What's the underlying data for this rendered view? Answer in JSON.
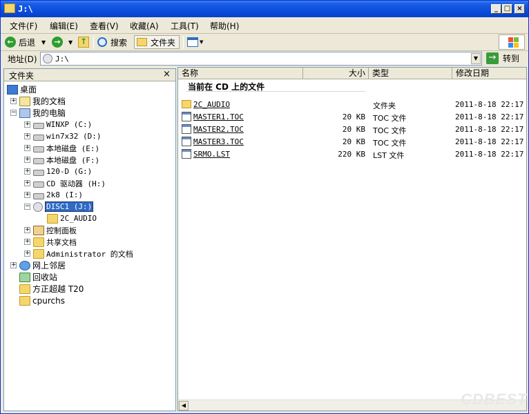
{
  "window": {
    "title": "J:\\",
    "minimize": "_",
    "maximize": "□",
    "close": "×"
  },
  "menu": [
    "文件(F)",
    "编辑(E)",
    "查看(V)",
    "收藏(A)",
    "工具(T)",
    "帮助(H)"
  ],
  "toolbar": {
    "back": "后退",
    "search": "搜索",
    "folders": "文件夹"
  },
  "address": {
    "label": "地址(D)",
    "value": "J:\\",
    "go": "转到"
  },
  "folder_pane": {
    "title": "文件夹",
    "close": "×"
  },
  "tree": [
    {
      "label": "桌面",
      "level": 0,
      "icon": "desktop-icon",
      "expander": ""
    },
    {
      "label": "我的文档",
      "level": 1,
      "icon": "my-documents-icon",
      "expander": "+"
    },
    {
      "label": "我的电脑",
      "level": 1,
      "icon": "my-computer-icon",
      "expander": "−"
    },
    {
      "label": "WINXP (C:)",
      "level": 2,
      "icon": "drive-icon",
      "expander": "+"
    },
    {
      "label": "win7x32 (D:)",
      "level": 2,
      "icon": "drive-icon",
      "expander": "+"
    },
    {
      "label": "本地磁盘 (E:)",
      "level": 2,
      "icon": "drive-icon",
      "expander": "+"
    },
    {
      "label": "本地磁盘 (F:)",
      "level": 2,
      "icon": "drive-icon",
      "expander": "+"
    },
    {
      "label": "120-D (G:)",
      "level": 2,
      "icon": "drive-icon",
      "expander": "+"
    },
    {
      "label": "CD 驱动器 (H:)",
      "level": 2,
      "icon": "cd-drive-icon",
      "expander": "+"
    },
    {
      "label": "2k8 (I:)",
      "level": 2,
      "icon": "drive-icon",
      "expander": "+"
    },
    {
      "label": "DISC1 (J:)",
      "level": 2,
      "icon": "cd-disc-icon",
      "expander": "−",
      "selected": true
    },
    {
      "label": "2C_AUDIO",
      "level": 3,
      "icon": "folder-icon",
      "expander": ""
    },
    {
      "label": "控制面板",
      "level": 2,
      "icon": "control-panel-icon",
      "expander": "+"
    },
    {
      "label": "共享文档",
      "level": 2,
      "icon": "folder-icon",
      "expander": "+"
    },
    {
      "label": "Administrator 的文档",
      "level": 2,
      "icon": "folder-icon",
      "expander": "+"
    },
    {
      "label": "网上邻居",
      "level": 1,
      "icon": "network-icon",
      "expander": "+"
    },
    {
      "label": "回收站",
      "level": 1,
      "icon": "recycle-bin-icon",
      "expander": ""
    },
    {
      "label": "方正超越 T20",
      "level": 1,
      "icon": "folder-icon",
      "expander": ""
    },
    {
      "label": "cpurchs",
      "level": 1,
      "icon": "folder-icon",
      "expander": ""
    }
  ],
  "columns": {
    "name": "名称",
    "size": "大小",
    "type": "类型",
    "modified": "修改日期"
  },
  "group_header": "当前在 CD 上的文件",
  "files": [
    {
      "name": "2C_AUDIO",
      "size": "",
      "type": "文件夹",
      "date": "2011-8-18 22:17",
      "icon": "folder-icon"
    },
    {
      "name": "MASTER1.TOC",
      "size": "20 KB",
      "type": "TOC 文件",
      "date": "2011-8-18 22:17",
      "icon": "toc-file-icon"
    },
    {
      "name": "MASTER2.TOC",
      "size": "20 KB",
      "type": "TOC 文件",
      "date": "2011-8-18 22:17",
      "icon": "toc-file-icon"
    },
    {
      "name": "MASTER3.TOC",
      "size": "20 KB",
      "type": "TOC 文件",
      "date": "2011-8-18 22:17",
      "icon": "toc-file-icon"
    },
    {
      "name": "SRMO.LST",
      "size": "220 KB",
      "type": "LST 文件",
      "date": "2011-8-18 22:17",
      "icon": "lst-file-icon"
    }
  ],
  "watermark": "CDBEST",
  "colors": {
    "titlebar": "#0a4ad8",
    "selection": "#316ac5",
    "chrome": "#ece9d8"
  }
}
